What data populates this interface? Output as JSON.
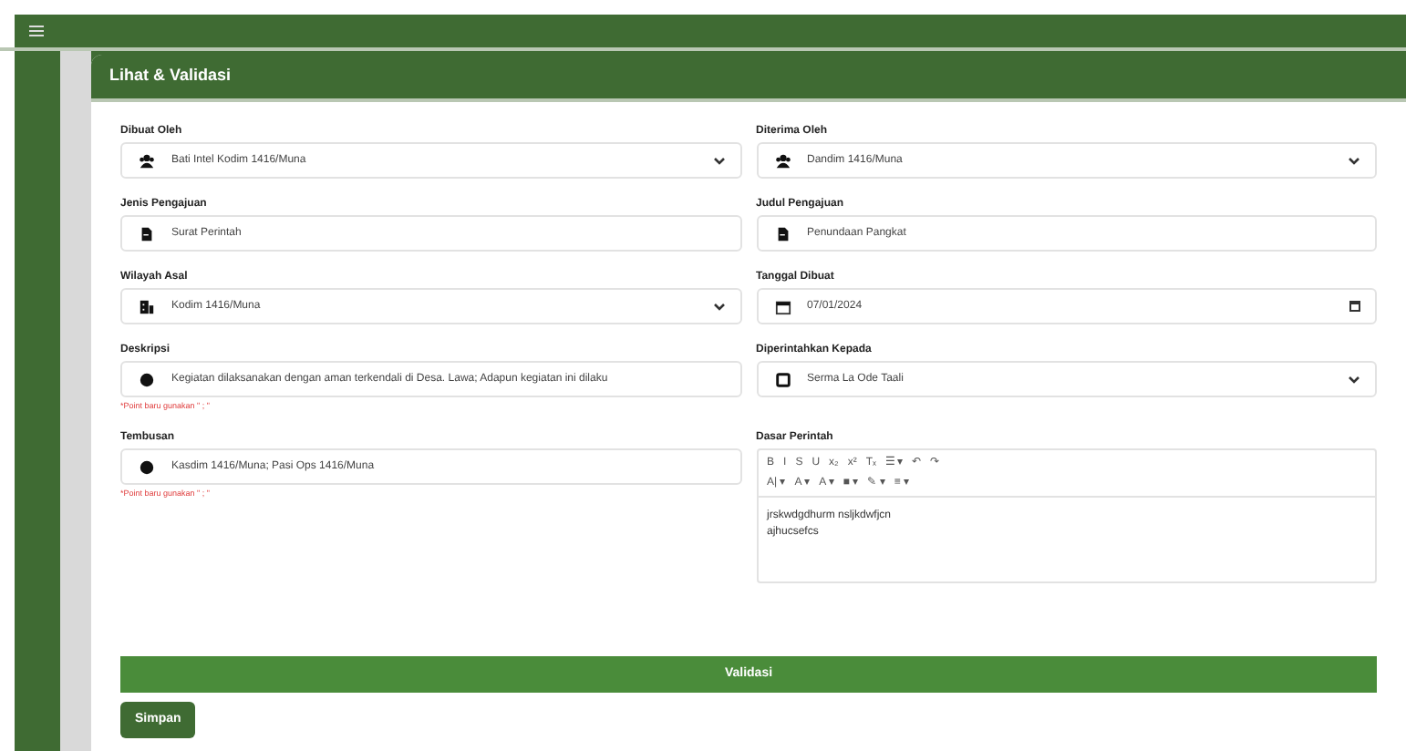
{
  "card": {
    "title": "Lihat & Validasi"
  },
  "fields": [
    {
      "label": "Dibuat Oleh",
      "kind": "select",
      "value": "Bati Intel Kodim 1416/Muna"
    },
    {
      "label": "Diterima Oleh",
      "kind": "select",
      "value": "Dandim 1416/Muna"
    },
    {
      "label": "Jenis Pengajuan",
      "kind": "text",
      "value": "Surat Perintah"
    },
    {
      "label": "Judul Pengajuan",
      "kind": "text",
      "value": "Penundaan Pangkat"
    },
    {
      "label": "Wilayah Asal",
      "kind": "select",
      "value": "Kodim 1416/Muna"
    },
    {
      "label": "Tanggal Dibuat",
      "kind": "date",
      "value": "07/01/2024"
    },
    {
      "label": "Deskripsi",
      "kind": "text",
      "value": "Kegiatan dilaksanakan dengan aman terkendali di Desa. Lawa; Adapun kegiatan ini dilaku",
      "hint": "*Point baru gunakan \" ; \""
    },
    {
      "label": "Diperintahkan Kepada",
      "kind": "select",
      "value": "Serma La Ode Taali"
    },
    {
      "label": "Tembusan",
      "kind": "text",
      "value": "Kasdim 1416/Muna; Pasi Ops 1416/Muna",
      "hint": "*Point baru gunakan \" ; \""
    }
  ],
  "editor": {
    "label": "Dasar Perintah",
    "toolbar": [
      [
        "B",
        "I",
        "S",
        "U",
        "x₂",
        "x²",
        "Tₓ",
        "☰ ▾",
        "↶",
        "↷"
      ],
      [
        "A| ▾",
        "A ▾",
        "A ▾",
        "■ ▾",
        "✎ ▾",
        "≡ ▾"
      ]
    ],
    "lines": [
      "jrskwdgdhurm nsljkdwfjcn",
      "ajhucsefcs"
    ]
  },
  "validate_bar": "Validasi",
  "save_button": "Simpan"
}
